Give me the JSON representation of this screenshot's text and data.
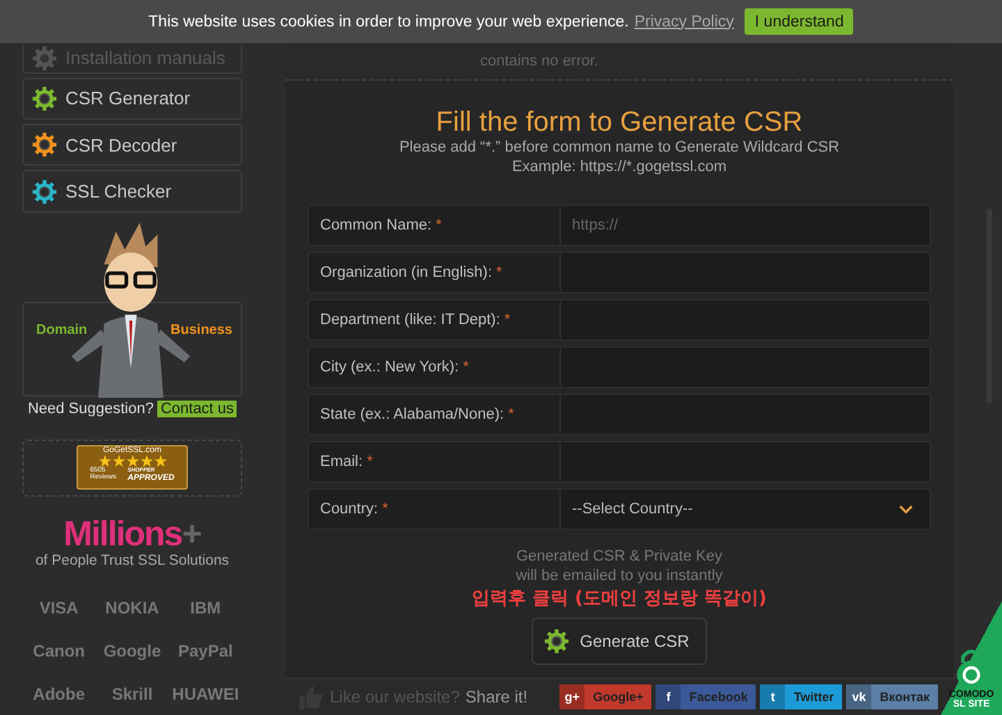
{
  "cookie_bar": {
    "message": "This website uses cookies in order to improve your web experience.",
    "link": "Privacy Policy",
    "button": "I understand"
  },
  "sidebar": {
    "items": [
      {
        "label": "Installation manuals",
        "kind": "manual",
        "faded": true
      },
      {
        "label": "CSR Generator",
        "kind": "gear",
        "color": "#7cb82f",
        "faded": false
      },
      {
        "label": "CSR Decoder",
        "kind": "gear",
        "color": "#f0921e",
        "faded": false
      },
      {
        "label": "SSL Checker",
        "kind": "gear",
        "color": "#2bb5c8",
        "faded": false
      }
    ],
    "mascot": {
      "left": "Domain",
      "right": "Business"
    },
    "suggestion": {
      "text": "Need Suggestion?",
      "link": "Contact us"
    },
    "badge": {
      "site": "GoGetSSL.com",
      "stars": 5,
      "count": "6505",
      "reviews": "Reviews",
      "top": "SHOPPER",
      "bottom": "APPROVED"
    },
    "trust": {
      "headline": "Millions",
      "plus": "+",
      "tagline": "of People Trust SSL Solutions"
    },
    "logos": [
      "VISA",
      "NOKIA",
      "IBM",
      "Canon",
      "Google",
      "PayPal",
      "Adobe",
      "Skrill",
      "HUAWEI"
    ]
  },
  "intro": {
    "text": "contains no error."
  },
  "form": {
    "title": "Fill the form to Generate CSR",
    "hint": "Please add “*.” before common name to Generate Wildcard CSR",
    "example": "Example: https://*.gogetssl.com",
    "fields": [
      {
        "label": "Common Name:",
        "mark": "*",
        "kind": "text",
        "placeholder": "https://"
      },
      {
        "label": "Organization (in English):",
        "mark": "*",
        "kind": "text"
      },
      {
        "label": "Department (like: IT Dept):",
        "mark": "*",
        "kind": "text"
      },
      {
        "label": "City (ex.: New York):",
        "mark": "*",
        "kind": "text"
      },
      {
        "label": "State (ex.: Alabama/None):",
        "mark": "*",
        "kind": "text"
      },
      {
        "label": "Email:",
        "mark": "*",
        "kind": "text"
      },
      {
        "label": "Country:",
        "mark": "*",
        "kind": "select",
        "value": "--Select Country--"
      }
    ],
    "note_1": "Generated CSR & Private Key",
    "note_2": "will be emailed to you instantly",
    "annotation": "입력후 클릭 (도메인 정보랑 똑같이)",
    "button": "Generate CSR"
  },
  "footer": {
    "text": "Like our website?",
    "link": "Share it!",
    "shares": [
      {
        "label": "Google+",
        "icon": "g+",
        "color": "#c0392b"
      },
      {
        "label": "Facebook",
        "icon": "f",
        "color": "#3b5998"
      },
      {
        "label": "Twitter",
        "icon": "t",
        "color": "#1d9bd9"
      },
      {
        "label": "Вконтак",
        "icon": "vk",
        "color": "#5b7fa6"
      }
    ]
  },
  "seal": {
    "brand": "COMODO",
    "caption": "SL SITE"
  }
}
